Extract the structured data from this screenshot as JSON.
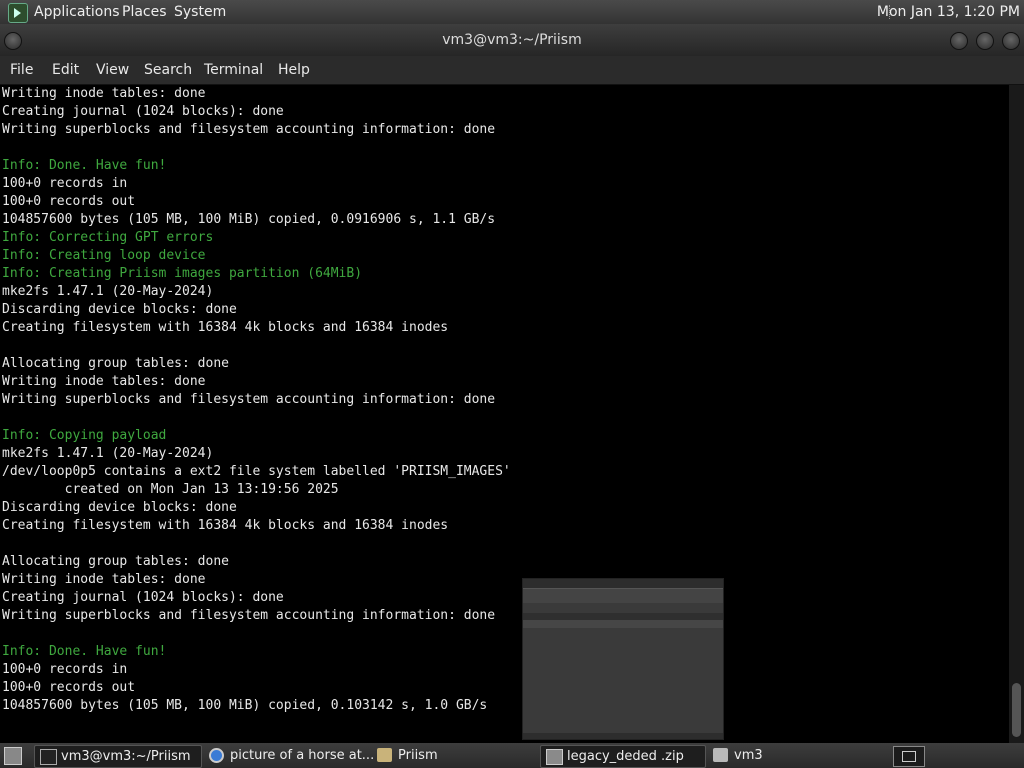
{
  "top_panel": {
    "menus": [
      "Applications",
      "Places",
      "System"
    ],
    "clock": "Mon Jan 13,  1:20 PM"
  },
  "window": {
    "title": "vm3@vm3:~/Priism"
  },
  "menubar": [
    "File",
    "Edit",
    "View",
    "Search",
    "Terminal",
    "Help"
  ],
  "terminal_lines": [
    {
      "text": "Writing inode tables: done",
      "type": "normal"
    },
    {
      "text": "Creating journal (1024 blocks): done",
      "type": "normal"
    },
    {
      "text": "Writing superblocks and filesystem accounting information: done",
      "type": "normal"
    },
    {
      "text": "",
      "type": "normal"
    },
    {
      "text": "Info: Done. Have fun!",
      "type": "info"
    },
    {
      "text": "100+0 records in",
      "type": "normal"
    },
    {
      "text": "100+0 records out",
      "type": "normal"
    },
    {
      "text": "104857600 bytes (105 MB, 100 MiB) copied, 0.0916906 s, 1.1 GB/s",
      "type": "normal"
    },
    {
      "text": "Info: Correcting GPT errors",
      "type": "info"
    },
    {
      "text": "Info: Creating loop device",
      "type": "info"
    },
    {
      "text": "Info: Creating Priism images partition (64MiB)",
      "type": "info"
    },
    {
      "text": "mke2fs 1.47.1 (20-May-2024)",
      "type": "normal"
    },
    {
      "text": "Discarding device blocks: done",
      "type": "normal"
    },
    {
      "text": "Creating filesystem with 16384 4k blocks and 16384 inodes",
      "type": "normal"
    },
    {
      "text": "",
      "type": "normal"
    },
    {
      "text": "Allocating group tables: done",
      "type": "normal"
    },
    {
      "text": "Writing inode tables: done",
      "type": "normal"
    },
    {
      "text": "Writing superblocks and filesystem accounting information: done",
      "type": "normal"
    },
    {
      "text": "",
      "type": "normal"
    },
    {
      "text": "Info: Copying payload",
      "type": "info"
    },
    {
      "text": "mke2fs 1.47.1 (20-May-2024)",
      "type": "normal"
    },
    {
      "text": "/dev/loop0p5 contains a ext2 file system labelled 'PRIISM_IMAGES'",
      "type": "normal"
    },
    {
      "text": "        created on Mon Jan 13 13:19:56 2025",
      "type": "normal"
    },
    {
      "text": "Discarding device blocks: done",
      "type": "normal"
    },
    {
      "text": "Creating filesystem with 16384 4k blocks and 16384 inodes",
      "type": "normal"
    },
    {
      "text": "",
      "type": "normal"
    },
    {
      "text": "Allocating group tables: done",
      "type": "normal"
    },
    {
      "text": "Writing inode tables: done",
      "type": "normal"
    },
    {
      "text": "Creating journal (1024 blocks): done",
      "type": "normal"
    },
    {
      "text": "Writing superblocks and filesystem accounting information: done",
      "type": "normal"
    },
    {
      "text": "",
      "type": "normal"
    },
    {
      "text": "Info: Done. Have fun!",
      "type": "info"
    },
    {
      "text": "100+0 records in",
      "type": "normal"
    },
    {
      "text": "100+0 records out",
      "type": "normal"
    },
    {
      "text": "104857600 bytes (105 MB, 100 MiB) copied, 0.103142 s, 1.0 GB/s",
      "type": "normal"
    }
  ],
  "taskbar": {
    "tasks": [
      {
        "label": "vm3@vm3:~/Priism",
        "icon": "terminal-icon",
        "active": true
      },
      {
        "label": "picture of a horse at...",
        "icon": "chrome-icon",
        "active": false
      },
      {
        "label": "Priism",
        "icon": "folder-icon",
        "active": false
      },
      {
        "label": "legacy_deded .zip",
        "icon": "archive-icon",
        "active": true
      },
      {
        "label": "vm3",
        "icon": "home-folder-icon",
        "active": false
      }
    ]
  },
  "colors": {
    "info_text": "#3fa83f",
    "terminal_bg": "#000000",
    "terminal_text": "#e8e8e8"
  }
}
